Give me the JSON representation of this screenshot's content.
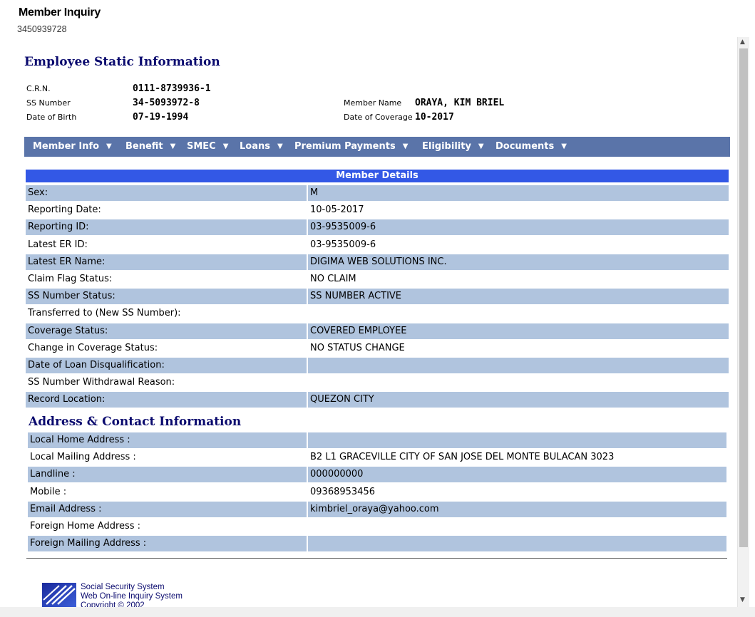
{
  "page": {
    "title": "Member Inquiry",
    "subtitle": "3450939728"
  },
  "static_info": {
    "title": "Employee Static Information",
    "crn_label": "C.R.N.",
    "crn_value": "0111-8739936-1",
    "ss_label": "SS Number",
    "ss_value": "34-5093972-8",
    "dob_label": "Date of Birth",
    "dob_value": "07-19-1994",
    "name_label": "Member Name",
    "name_value": "ORAYA, KIM BRIEL",
    "coverage_label": "Date of Coverage",
    "coverage_value": "10-2017"
  },
  "nav": {
    "items": [
      {
        "label": "Member Info",
        "icon": "triangle-down-icon"
      },
      {
        "label": "Benefit",
        "icon": "triangle-down-icon"
      },
      {
        "label": "SMEC",
        "icon": "triangle-down-icon"
      },
      {
        "label": "Loans",
        "icon": "triangle-down-icon"
      },
      {
        "label": "Premium Payments",
        "icon": "triangle-down-icon"
      },
      {
        "label": "Eligibility",
        "icon": "triangle-down-icon"
      },
      {
        "label": "Documents",
        "icon": "triangle-down-icon"
      }
    ],
    "caret": "▼"
  },
  "member_details": {
    "title": "Member Details",
    "rows": [
      {
        "label": "Sex:",
        "value": "M"
      },
      {
        "label": "Reporting Date:",
        "value": "10-05-2017"
      },
      {
        "label": "Reporting ID:",
        "value": "03-9535009-6"
      },
      {
        "label": "Latest ER ID:",
        "value": "03-9535009-6"
      },
      {
        "label": "Latest ER Name:",
        "value": "DIGIMA WEB SOLUTIONS INC."
      },
      {
        "label": "Claim Flag Status:",
        "value": "NO CLAIM"
      },
      {
        "label": "SS Number Status:",
        "value": "SS NUMBER ACTIVE"
      },
      {
        "label": "Transferred to (New SS Number):",
        "value": ""
      },
      {
        "label": "Coverage Status:",
        "value": "COVERED EMPLOYEE"
      },
      {
        "label": "Change in Coverage Status:",
        "value": "NO STATUS CHANGE"
      },
      {
        "label": "Date of Loan Disqualification:",
        "value": ""
      },
      {
        "label": "SS Number Withdrawal Reason:",
        "value": ""
      },
      {
        "label": "Record Location:",
        "value": "QUEZON CITY"
      }
    ]
  },
  "address": {
    "title": "Address & Contact Information",
    "rows": [
      {
        "label": "Local Home Address :",
        "value": ""
      },
      {
        "label": "Local Mailing Address :",
        "value": "B2 L1 GRACEVILLE CITY OF SAN JOSE DEL MONTE BULACAN 3023"
      },
      {
        "label": "Landline :",
        "value": "000000000"
      },
      {
        "label": "Mobile :",
        "value": "09368953456"
      },
      {
        "label": "Email Address :",
        "value": "kimbriel_oraya@yahoo.com"
      },
      {
        "label": "Foreign Home Address :",
        "value": ""
      },
      {
        "label": "Foreign Mailing Address :",
        "value": ""
      }
    ]
  },
  "footer": {
    "line1": "Social Security System",
    "line2": "Web On-line Inquiry System",
    "line3": "Copyright © 2002",
    "logo_icon": "sss-logo-icon"
  },
  "colors": {
    "nav_bg": "#5a74a9",
    "header_bar": "#3358e6",
    "row_shade": "#b0c4de",
    "title_navy": "#0a0a6e"
  }
}
